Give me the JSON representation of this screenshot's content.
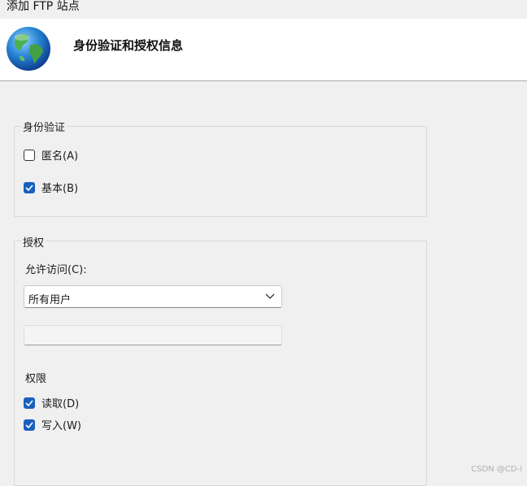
{
  "window": {
    "title": "添加 FTP 站点"
  },
  "header": {
    "title": "身份验证和授权信息",
    "icon": "globe-icon"
  },
  "authentication": {
    "legend": "身份验证",
    "anonymous": {
      "label": "匿名(A)",
      "checked": false
    },
    "basic": {
      "label": "基本(B)",
      "checked": true
    }
  },
  "authorization": {
    "legend": "授权",
    "allow_access_label": "允许访问(C):",
    "allow_access_value": "所有用户",
    "user_field_value": "",
    "permissions_label": "权限",
    "read": {
      "label": "读取(D)",
      "checked": true
    },
    "write": {
      "label": "写入(W)",
      "checked": true
    }
  },
  "watermark": "CSDN @CD-i",
  "colors": {
    "checkbox_checked": "#1b5fbd",
    "header_bg": "#ffffff",
    "body_bg": "#f0f0f0"
  }
}
